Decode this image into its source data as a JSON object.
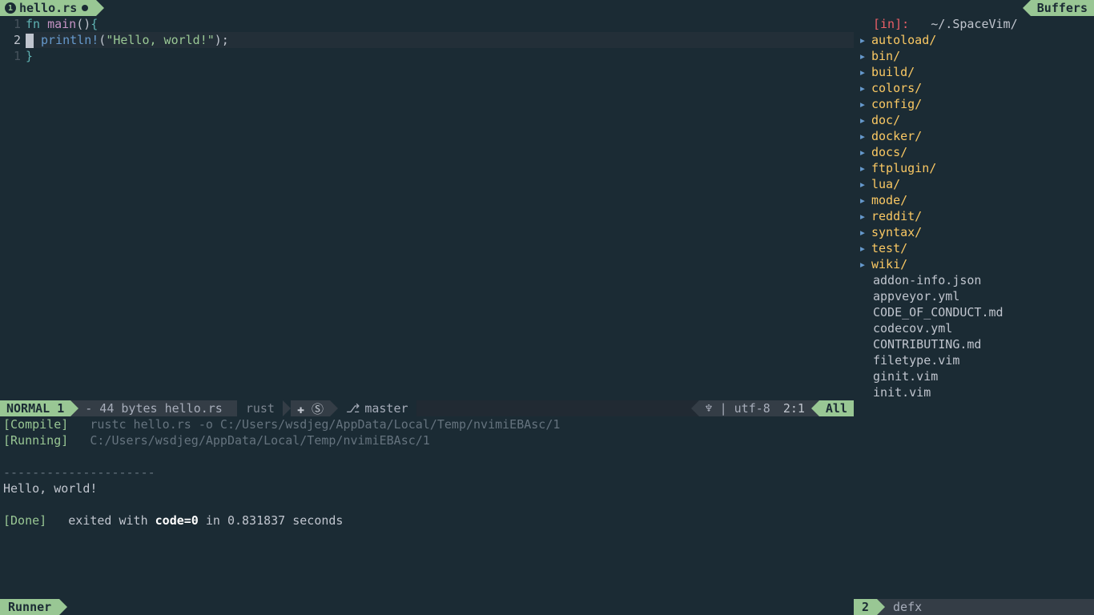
{
  "tabs": {
    "active_index": "1",
    "active_name": "hello.rs"
  },
  "buffers_label": "Buffers",
  "code": {
    "lines": [
      {
        "gutter": "1",
        "html": "<span class='kw'>fn</span> <span class='fn'>main</span><span class='punct'>()</span><span class='brace'>{</span>",
        "current": false
      },
      {
        "gutter": "2",
        "html": "<span class='cursor-block'></span>   <span class='macro'>println!</span><span class='punct'>(</span><span class='str'>\"Hello, world!\"</span><span class='punct'>);</span>",
        "current": true
      },
      {
        "gutter": "1",
        "html": "<span class='brace'>}</span>",
        "current": false
      }
    ]
  },
  "status_left": {
    "mode": "NORMAL",
    "mode_num": "1",
    "file_info": "- 44 bytes hello.rs",
    "filetype": "rust",
    "icons": "✚ Ⓢ",
    "branch_icon": "⎇",
    "branch": "master"
  },
  "status_right": {
    "linux_icon": "♆",
    "bar": "|",
    "encoding": "utf-8",
    "position": "2:1",
    "percent": "All"
  },
  "status_side": {
    "num": "2",
    "name": "defx"
  },
  "sidebar": {
    "header_key": "[in]:",
    "header_path": "~/.SpaceVim/",
    "dirs": [
      "autoload/",
      "bin/",
      "build/",
      "colors/",
      "config/",
      "doc/",
      "docker/",
      "docs/",
      "ftplugin/",
      "lua/",
      "mode/",
      "reddit/",
      "syntax/",
      "test/",
      "wiki/"
    ],
    "files": [
      "addon-info.json",
      "appveyor.yml",
      "CODE_OF_CONDUCT.md",
      "codecov.yml",
      "CONTRIBUTING.md",
      "filetype.vim",
      "ginit.vim",
      "init.vim"
    ]
  },
  "runner": {
    "compile_tag": "[Compile]",
    "compile_cmd": "rustc hello.rs -o C:/Users/wsdjeg/AppData/Local/Temp/nvimiEBAsc/1",
    "running_tag": "[Running]",
    "running_cmd": "C:/Users/wsdjeg/AppData/Local/Temp/nvimiEBAsc/1",
    "separator": "---------------------",
    "output": "Hello, world!",
    "done_tag": "[Done]",
    "done_text_a": "exited with ",
    "done_code": "code=0",
    "done_text_b": " in 0.831837 seconds"
  },
  "runner_tab": "Runner"
}
